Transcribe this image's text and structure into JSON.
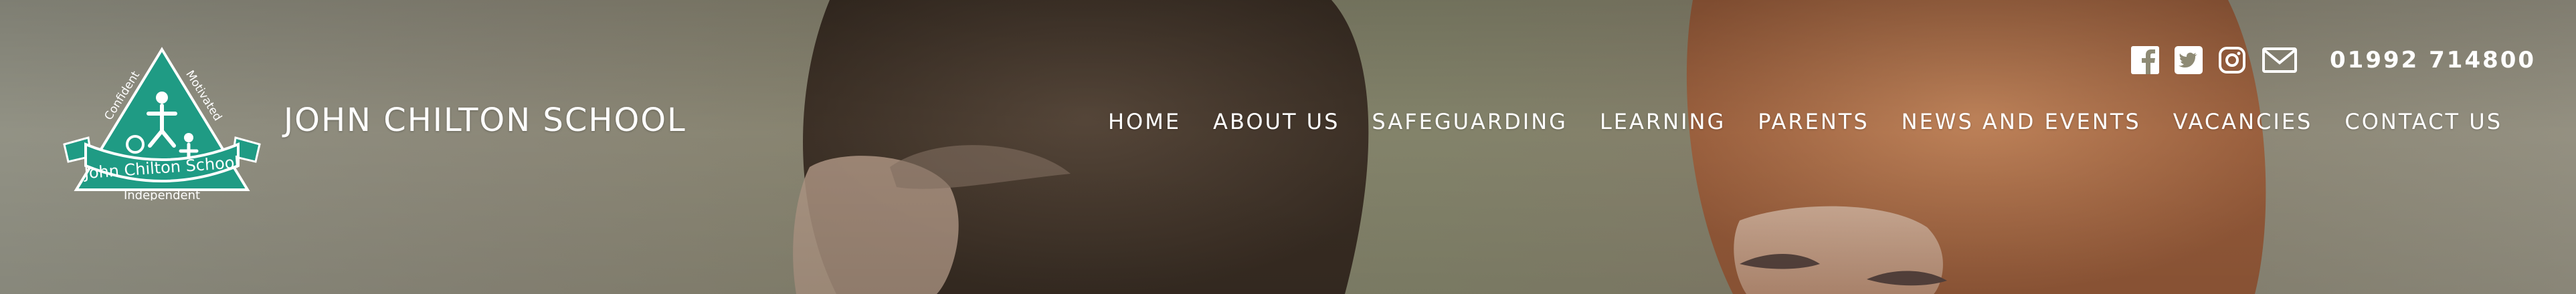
{
  "brand": {
    "name": "JOHN CHILTON SCHOOL",
    "logo_banner": "John Chilton School",
    "logo_words": [
      "Confident",
      "Motivated",
      "Independent"
    ]
  },
  "contact": {
    "phone": "01992 714800"
  },
  "social": [
    {
      "name": "facebook-icon"
    },
    {
      "name": "twitter-icon"
    },
    {
      "name": "instagram-icon"
    },
    {
      "name": "email-icon"
    }
  ],
  "nav": {
    "items": [
      "HOME",
      "ABOUT US",
      "SAFEGUARDING",
      "LEARNING",
      "PARENTS",
      "NEWS AND EVENTS",
      "VACANCIES",
      "CONTACT US"
    ]
  },
  "colors": {
    "logo_teal": "#1f9b84",
    "text": "#ffffff"
  }
}
